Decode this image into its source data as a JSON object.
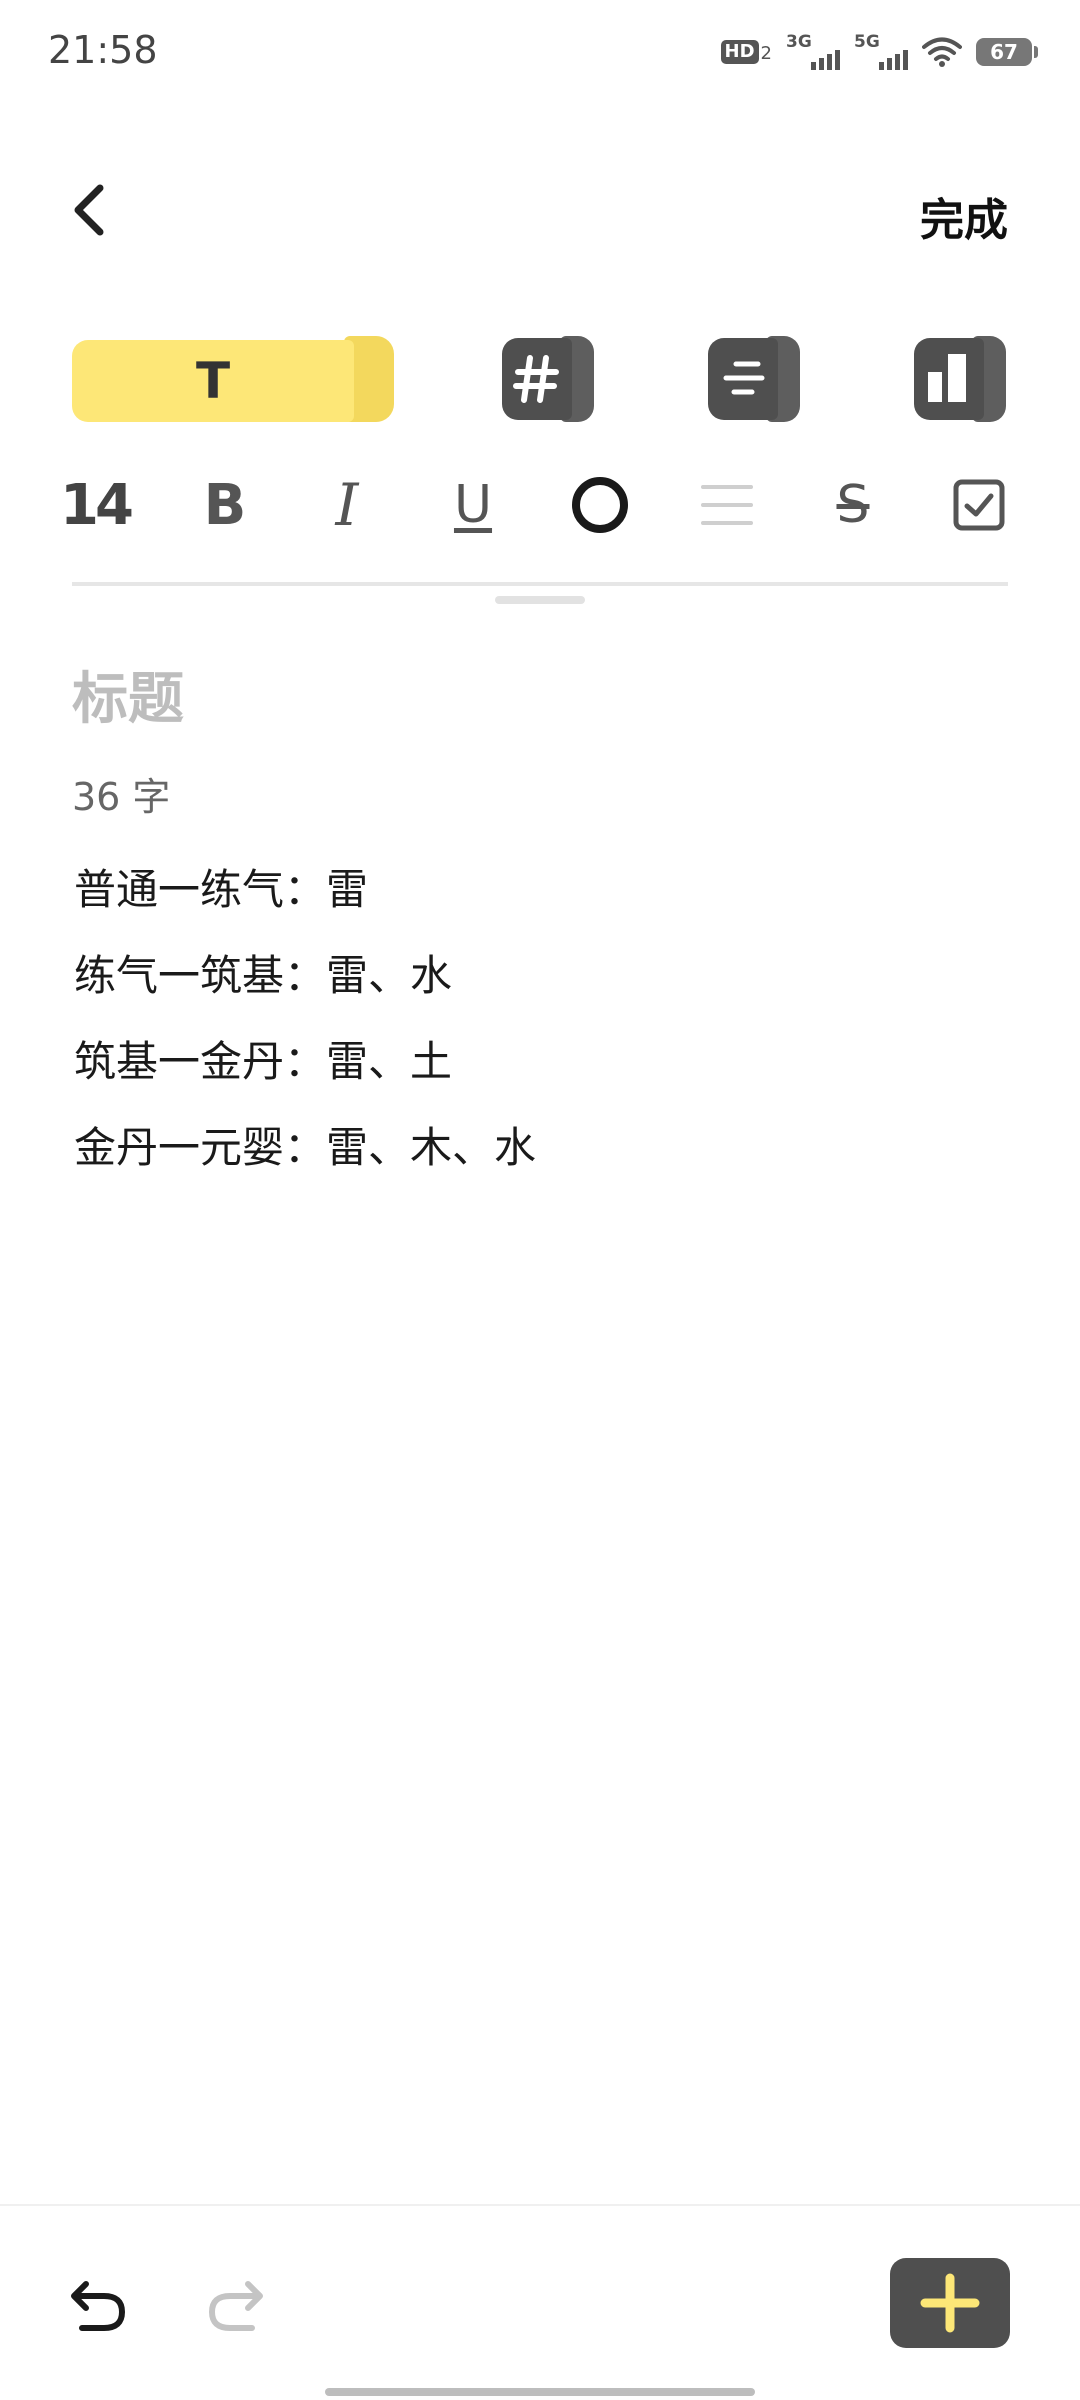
{
  "status_bar": {
    "time": "21:58",
    "hd_label": "HD",
    "hd_sub": "2",
    "net1": "3G",
    "net2": "5G",
    "battery": "67"
  },
  "header": {
    "back_icon": "chevron-left-icon",
    "done_label": "完成"
  },
  "style_tiles": {
    "text_tile_glyph": "T",
    "icons": [
      "hash-icon",
      "lines-icon",
      "layout-icon"
    ],
    "accent": "#fde777"
  },
  "format_toolbar": {
    "font_size": "14",
    "bold": "B",
    "italic": "I",
    "underline": "U",
    "strike": "S"
  },
  "editor": {
    "title_placeholder": "标题",
    "word_count": "36 字",
    "lines": [
      "普通一练气：雷",
      "练气一筑基：雷、水",
      "筑基一金丹：雷、土",
      "金丹一元婴：雷、木、水"
    ]
  },
  "bottom_bar": {
    "icons": [
      "undo-icon",
      "redo-icon",
      "plus-icon"
    ],
    "plus_color": "#fde777"
  }
}
